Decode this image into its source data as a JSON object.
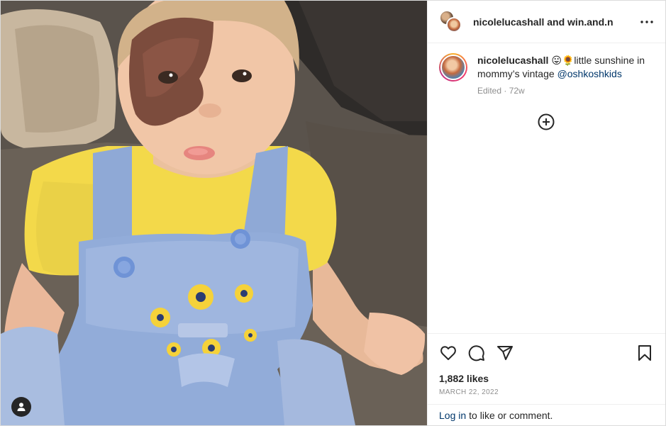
{
  "header": {
    "users_text": "nicolelucashall and win.and.n",
    "more_icon": "more-horizontal-icon"
  },
  "caption": {
    "username": "nicolelucashall",
    "emojis": "😛🌻",
    "text_before_mention": "little sunshine in mommy’s vintage ",
    "mention": "@oshkoshkids",
    "edited": "Edited",
    "age": "72w"
  },
  "actions": {
    "like_icon": "heart-icon",
    "comment_icon": "comment-icon",
    "share_icon": "paper-plane-icon",
    "save_icon": "bookmark-icon",
    "likes": "1,882 likes",
    "date": "MARCH 22, 2022"
  },
  "footer": {
    "login_link": "Log in",
    "login_rest": "to like or comment."
  },
  "colors": {
    "link": "#00376b",
    "muted": "#8e8e8e",
    "text": "#262626",
    "border": "#efefef"
  }
}
